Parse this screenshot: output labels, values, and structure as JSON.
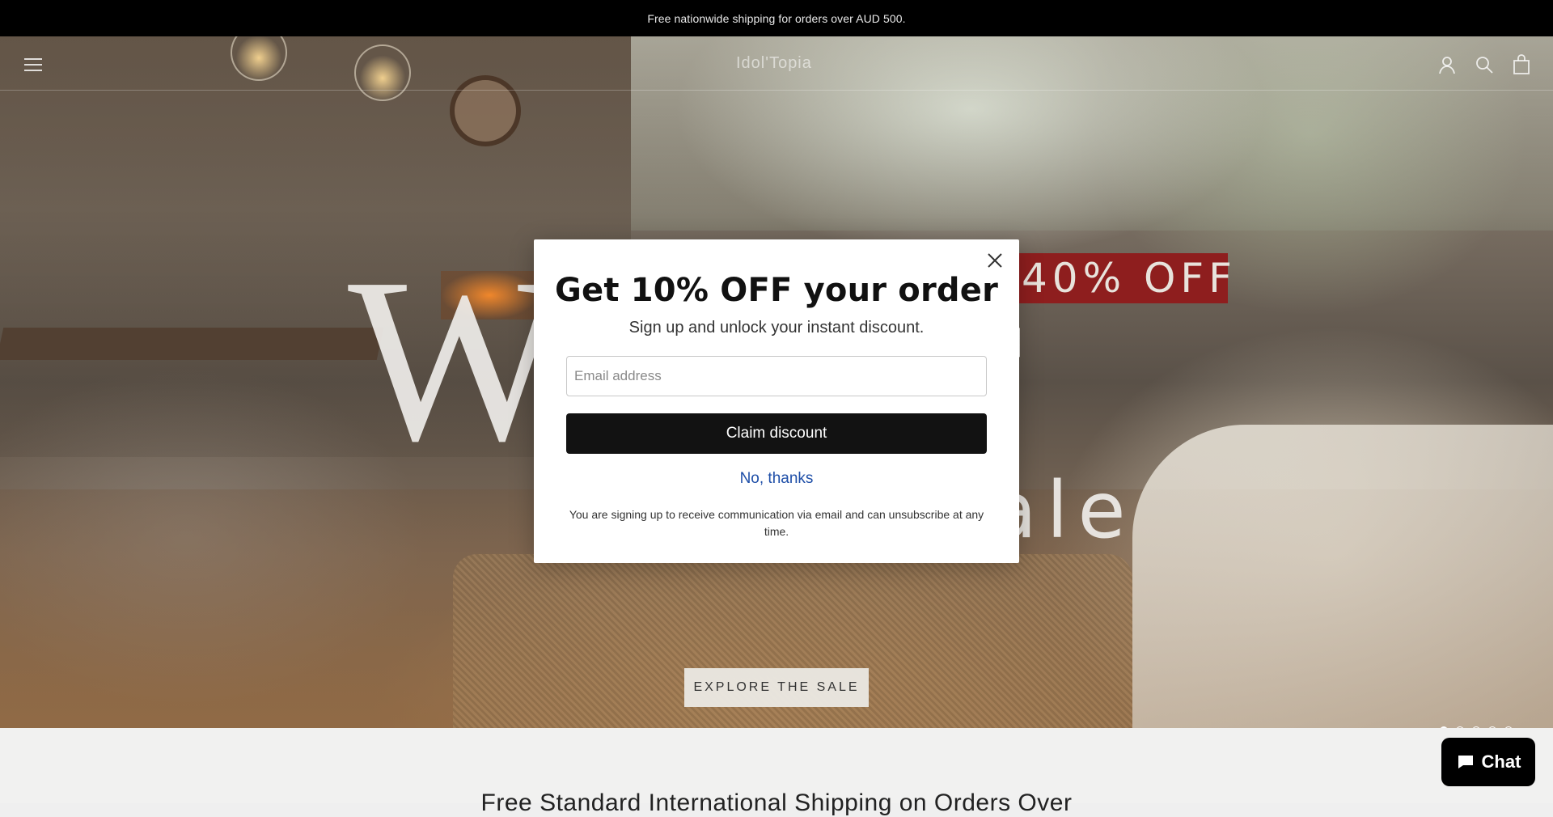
{
  "announcement": {
    "text": "Free nationwide shipping for orders over AUD 500."
  },
  "header": {
    "logo": "Idol'Topia",
    "icons": [
      "menu-icon",
      "account-icon",
      "search-icon",
      "cart-icon"
    ]
  },
  "hero": {
    "banner": "40% OFF",
    "title": "Winter",
    "subtitle": "Sale",
    "cta": "EXPLORE THE SALE",
    "slides_total": 5,
    "active_slide": 1
  },
  "modal": {
    "heading": "Get 10% OFF your order",
    "subheading": "Sign up and unlock your instant discount.",
    "email_placeholder": "Email address",
    "claim_label": "Claim discount",
    "decline_label": "No, thanks",
    "disclaimer": "You are signing up to receive communication via email and can unsubscribe at any time."
  },
  "below": {
    "text": "Free Standard International Shipping on Orders Over"
  },
  "chat": {
    "label": "Chat"
  },
  "colors": {
    "announcement_bg": "#000000",
    "banner_red": "#8e1e1e",
    "button_dark": "#121212",
    "link_blue": "#1f4fa8"
  }
}
